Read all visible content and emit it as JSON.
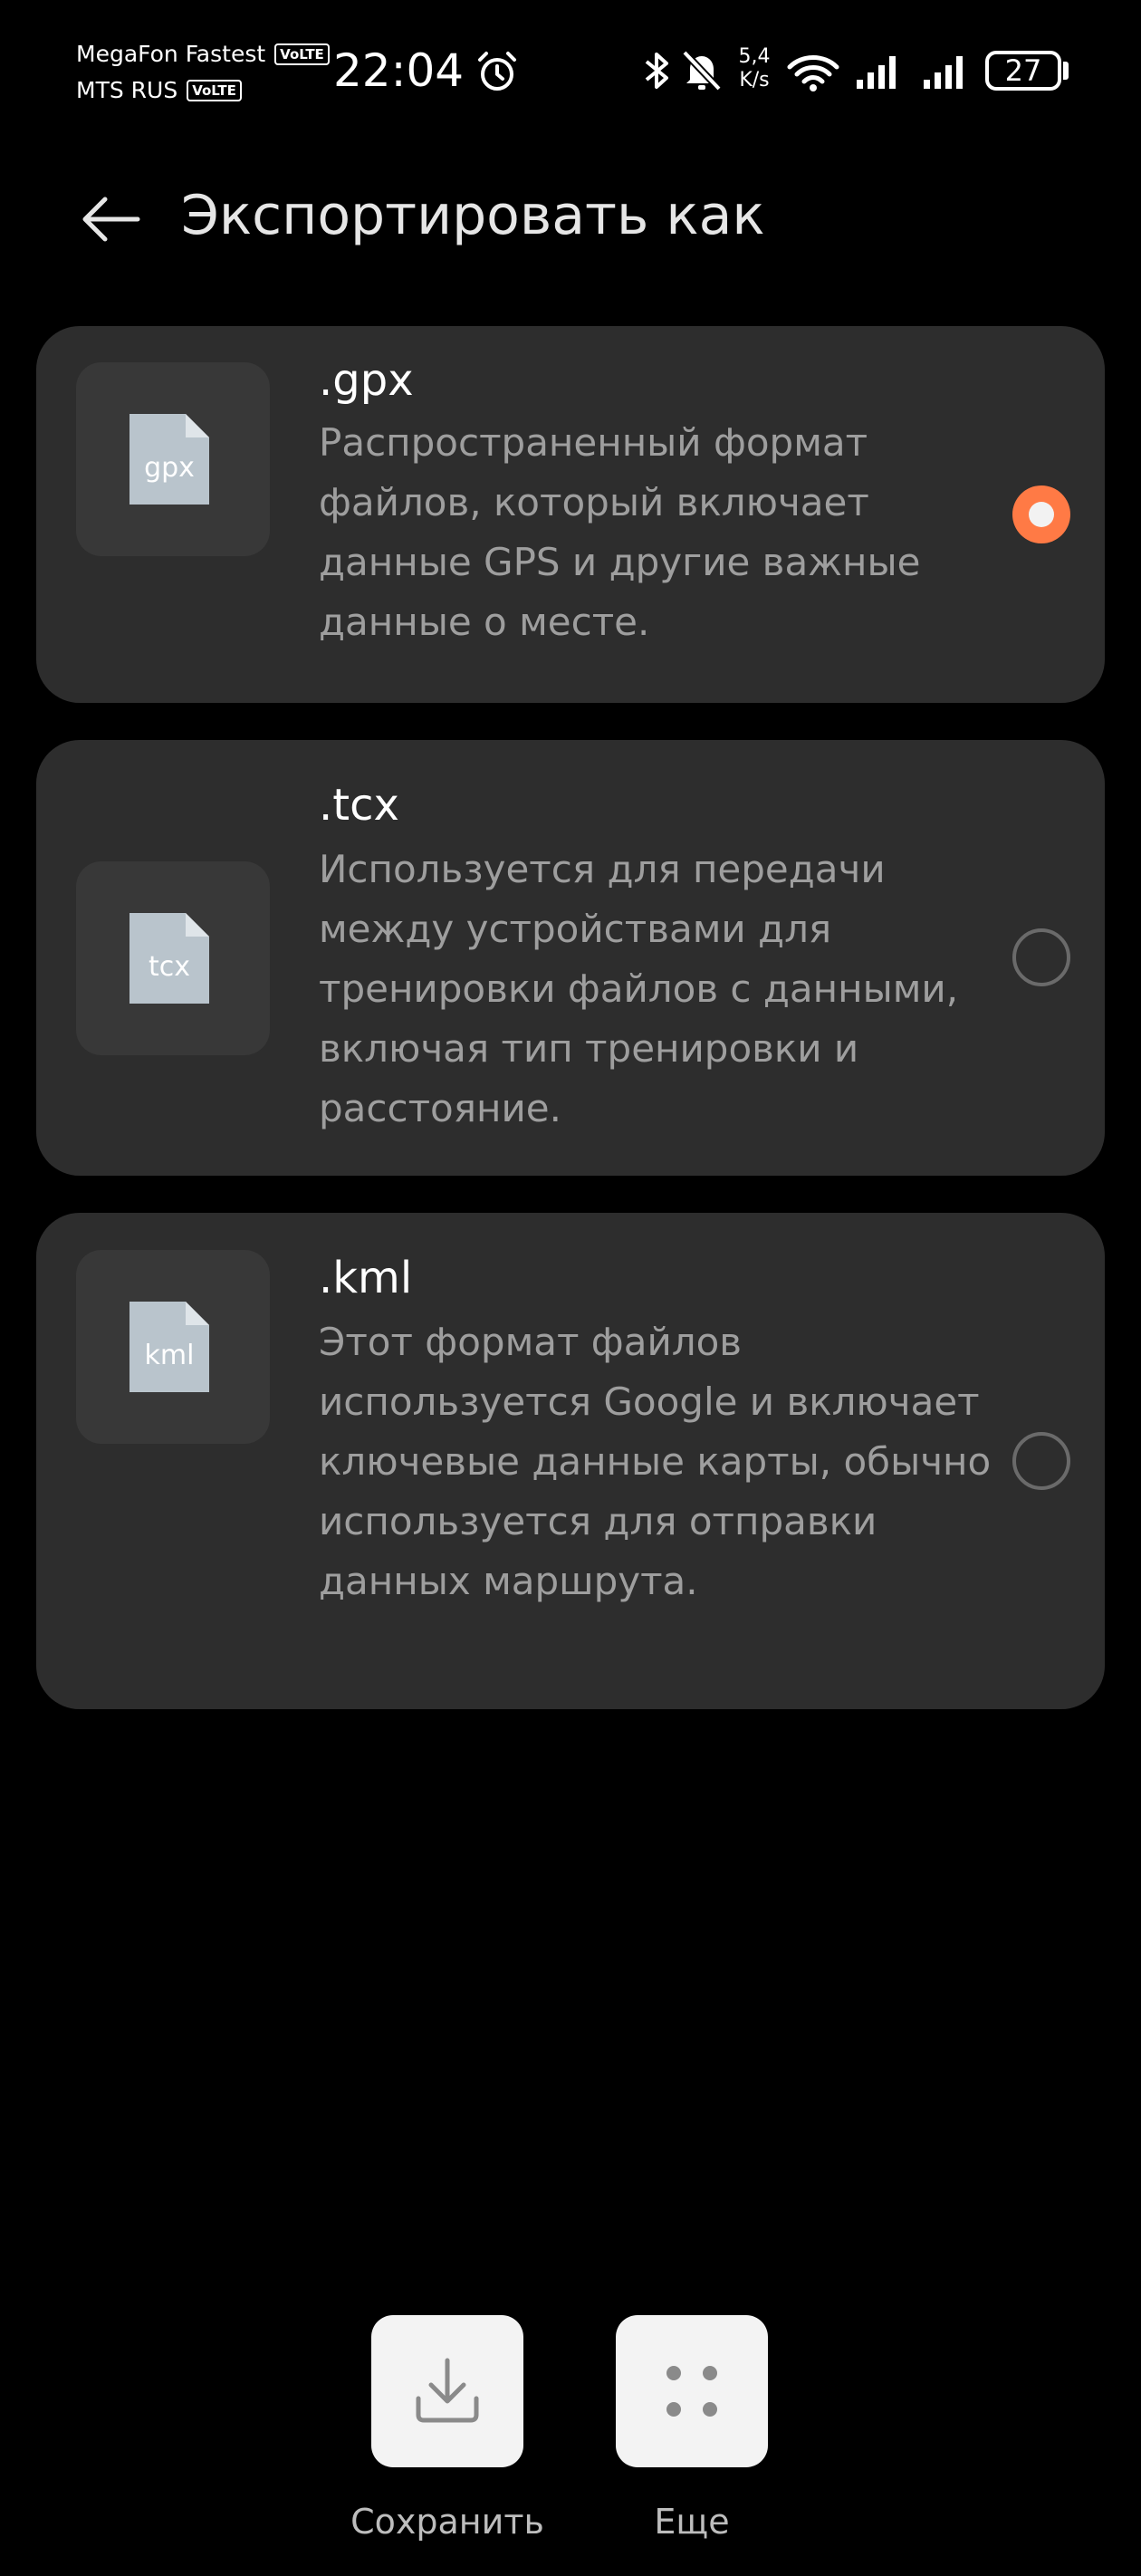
{
  "status_bar": {
    "carrier_1": "MegaFon Fastest",
    "carrier_1_badge": "VoLTE",
    "carrier_2": "MTS RUS",
    "carrier_2_badge": "VoLTE",
    "time": "22:04",
    "net_speed_value": "5,4",
    "net_speed_unit": "K/s",
    "battery": "27",
    "icons": [
      "alarm-icon",
      "bluetooth-icon",
      "muted-bell-icon",
      "wifi-icon",
      "signal-icon",
      "signal-icon"
    ]
  },
  "header": {
    "title": "Экспортировать как",
    "back_icon": "arrow-left-icon"
  },
  "formats": [
    {
      "title": ".gpx",
      "icon_label": "gpx",
      "description": "Распространенный формат файлов, который включает данные GPS и другие важные данные о месте.",
      "selected": true
    },
    {
      "title": ".tcx",
      "icon_label": "tcx",
      "description": "Используется для передачи между устройствами для тренировки файлов с данными, включая тип тренировки и расстояние.",
      "selected": false
    },
    {
      "title": ".kml",
      "icon_label": "kml",
      "description": "Этот формат файлов используется Google и включает ключевые данные карты, обычно используется для отправки данных маршрута.",
      "selected": false
    }
  ],
  "actions": {
    "save_label": "Сохранить",
    "more_label": "Еще"
  },
  "colors": {
    "background": "#000000",
    "card": "#2d2d2d",
    "accent": "#ff7a45",
    "file_icon": "#b9c4cc"
  }
}
